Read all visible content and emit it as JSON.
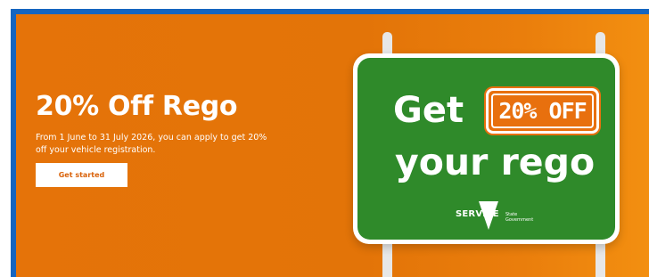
{
  "promo": {
    "title": "20% Off Rego",
    "description": "From 1 June to 31 July 2026, you can apply to get 20% off your vehicle registration.",
    "cta_label": "Get started"
  },
  "sign": {
    "line1": "Get",
    "plate_text": "20% OFF",
    "line2": "your rego"
  },
  "logo": {
    "service_text": "SERVICE",
    "gov_line1": "State",
    "gov_line2": "Government",
    "icon": "victoria-triangle-icon"
  },
  "colors": {
    "banner_orange": "#e57309",
    "frame_blue": "#1565c0",
    "sign_green": "#2f8a2a",
    "plate_orange": "#e8700e",
    "cta_text": "#d9620a"
  }
}
